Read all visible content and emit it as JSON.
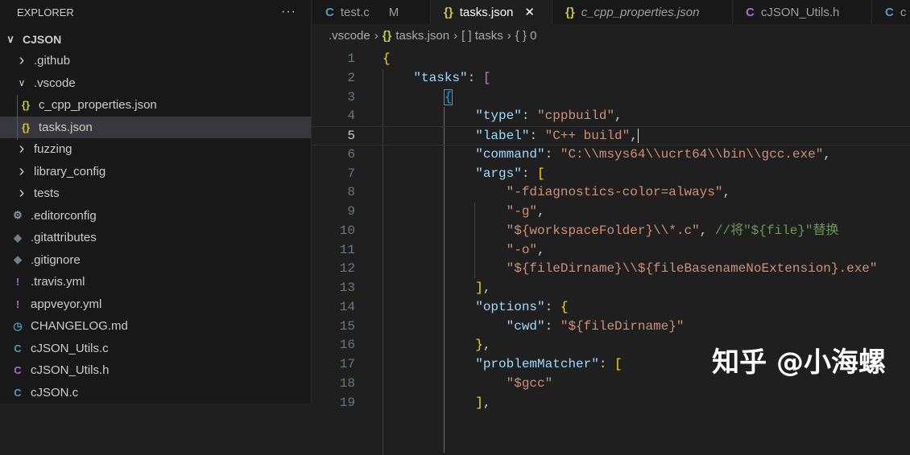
{
  "sidebar": {
    "title": "EXPLORER",
    "more": "···",
    "root": "CJSON",
    "items": [
      {
        "label": ".github",
        "type": "folder",
        "open": false,
        "icon": "chevron",
        "depth": 1
      },
      {
        "label": ".vscode",
        "type": "folder",
        "open": true,
        "icon": "chevron",
        "depth": 1
      },
      {
        "label": "c_cpp_properties.json",
        "icon": "{}",
        "color": "#cbcb41",
        "depth": 2
      },
      {
        "label": "tasks.json",
        "icon": "{}",
        "color": "#cbcb41",
        "depth": 2,
        "selected": true
      },
      {
        "label": "fuzzing",
        "type": "folder",
        "open": false,
        "depth": 1
      },
      {
        "label": "library_config",
        "type": "folder",
        "open": false,
        "depth": 1
      },
      {
        "label": "tests",
        "type": "folder",
        "open": false,
        "depth": 1
      },
      {
        "label": ".editorconfig",
        "icon": "⚙",
        "color": "#8a9aa8",
        "depth": 0
      },
      {
        "label": ".gitattributes",
        "icon": "◆",
        "color": "#6d8086",
        "depth": 0
      },
      {
        "label": ".gitignore",
        "icon": "◆",
        "color": "#6d8086",
        "depth": 0
      },
      {
        "label": ".travis.yml",
        "icon": "!",
        "color": "#a074c4",
        "depth": 0
      },
      {
        "label": "appveyor.yml",
        "icon": "!",
        "color": "#a074c4",
        "depth": 0
      },
      {
        "label": "CHANGELOG.md",
        "icon": "◷",
        "color": "#519aba",
        "depth": 0
      },
      {
        "label": "cJSON_Utils.c",
        "icon": "C",
        "color": "#519aba",
        "depth": 0
      },
      {
        "label": "cJSON_Utils.h",
        "icon": "C",
        "color": "#a074c4",
        "depth": 0
      },
      {
        "label": "cJSON.c",
        "icon": "C",
        "color": "#519aba",
        "depth": 0
      }
    ]
  },
  "tabs": [
    {
      "label": "test.c",
      "icon": "C",
      "color": "#519aba",
      "badge": "M"
    },
    {
      "label": "tasks.json",
      "icon": "{}",
      "color": "#cbcb41",
      "active": true,
      "close": "✕"
    },
    {
      "label": "c_cpp_properties.json",
      "icon": "{}",
      "color": "#cbcb41",
      "italic": true
    },
    {
      "label": "cJSON_Utils.h",
      "icon": "C",
      "color": "#a074c4"
    },
    {
      "label": "c",
      "icon": "C",
      "color": "#519aba"
    }
  ],
  "breadcrumb": {
    "a": ".vscode",
    "b": "tasks.json",
    "c": "[ ] tasks",
    "d": "{ } 0",
    "sep": "›",
    "jsonicon": "{}"
  },
  "code": [
    [
      [
        "b1",
        "{"
      ]
    ],
    [
      [
        "p",
        "    "
      ],
      [
        "k",
        "\"tasks\""
      ],
      [
        "p",
        ": "
      ],
      [
        "b2",
        "["
      ]
    ],
    [
      [
        "p",
        "        "
      ],
      [
        "b3 bm",
        "{"
      ]
    ],
    [
      [
        "p",
        "            "
      ],
      [
        "k",
        "\"type\""
      ],
      [
        "p",
        ": "
      ],
      [
        "s",
        "\"cppbuild\""
      ],
      [
        "p",
        ","
      ]
    ],
    [
      [
        "p",
        "            "
      ],
      [
        "k",
        "\"label\""
      ],
      [
        "p",
        ": "
      ],
      [
        "s",
        "\"C++ build\""
      ],
      [
        "p caret",
        ","
      ]
    ],
    [
      [
        "p",
        "            "
      ],
      [
        "k",
        "\"command\""
      ],
      [
        "p",
        ": "
      ],
      [
        "s",
        "\"C:\\\\msys64\\\\ucrt64\\\\bin\\\\gcc.exe\""
      ],
      [
        "p",
        ","
      ]
    ],
    [
      [
        "p",
        "            "
      ],
      [
        "k",
        "\"args\""
      ],
      [
        "p",
        ": "
      ],
      [
        "b1",
        "["
      ]
    ],
    [
      [
        "p",
        "                "
      ],
      [
        "s",
        "\"-fdiagnostics-color=always\""
      ],
      [
        "p",
        ","
      ]
    ],
    [
      [
        "p",
        "                "
      ],
      [
        "s",
        "\"-g\""
      ],
      [
        "p",
        ","
      ]
    ],
    [
      [
        "p",
        "                "
      ],
      [
        "s",
        "\"${workspaceFolder}\\\\*.c\""
      ],
      [
        "p",
        ", "
      ],
      [
        "c",
        "//将\"${file}\"替换"
      ]
    ],
    [
      [
        "p",
        "                "
      ],
      [
        "s",
        "\"-o\""
      ],
      [
        "p",
        ","
      ]
    ],
    [
      [
        "p",
        "                "
      ],
      [
        "s",
        "\"${fileDirname}\\\\${fileBasenameNoExtension}.exe\""
      ]
    ],
    [
      [
        "p",
        "            "
      ],
      [
        "b1",
        "]"
      ],
      [
        "p",
        ","
      ]
    ],
    [
      [
        "p",
        "            "
      ],
      [
        "k",
        "\"options\""
      ],
      [
        "p",
        ": "
      ],
      [
        "b1",
        "{"
      ]
    ],
    [
      [
        "p",
        "                "
      ],
      [
        "k",
        "\"cwd\""
      ],
      [
        "p",
        ": "
      ],
      [
        "s",
        "\"${fileDirname}\""
      ]
    ],
    [
      [
        "p",
        "            "
      ],
      [
        "b1",
        "}"
      ],
      [
        "p",
        ","
      ]
    ],
    [
      [
        "p",
        "            "
      ],
      [
        "k",
        "\"problemMatcher\""
      ],
      [
        "p",
        ": "
      ],
      [
        "b1",
        "["
      ]
    ],
    [
      [
        "p",
        "                "
      ],
      [
        "s",
        "\"$gcc\""
      ]
    ],
    [
      [
        "p",
        "            "
      ],
      [
        "b1",
        "]"
      ],
      [
        "p",
        ","
      ]
    ]
  ],
  "current_line": 5,
  "watermark": "知乎 @小海螺"
}
